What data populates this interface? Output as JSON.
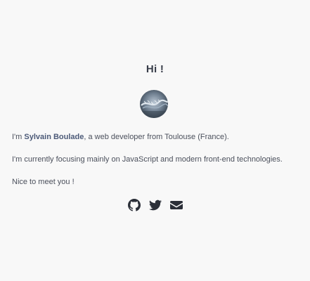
{
  "header": {
    "title": "Hi !"
  },
  "avatar": {
    "alt": "Sylvain Boulade"
  },
  "intro": {
    "line1_prefix": "I'm ",
    "name": "Sylvain Boulade",
    "line1_suffix": ", a web developer from Toulouse (France).",
    "line2": "I'm currently focusing mainly on JavaScript and modern front-end technologies.",
    "line3": "Nice to meet you !"
  },
  "social": {
    "links": [
      {
        "icon": "github-icon"
      },
      {
        "icon": "twitter-icon"
      },
      {
        "icon": "email-icon"
      }
    ]
  },
  "colors": {
    "background": "#f8f8f8",
    "text": "#4b505c",
    "name": "#4c5a78",
    "icon": "#2b2f38"
  }
}
